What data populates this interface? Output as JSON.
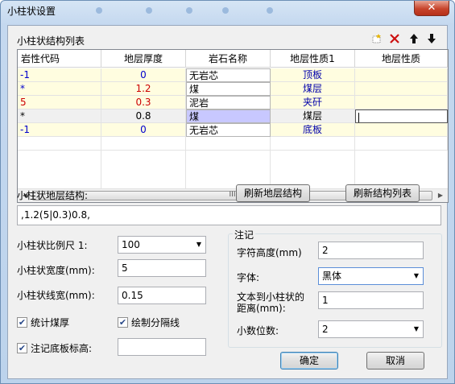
{
  "window": {
    "title": "小柱状设置",
    "close_glyph": "✕"
  },
  "grid": {
    "label": "小柱状结构列表",
    "columns": [
      "岩性代码",
      "地层厚度",
      "岩石名称",
      "地层性质1",
      "地层性质"
    ],
    "rows": [
      {
        "code": "-1",
        "thickness": "0",
        "rock": "无岩芯",
        "prop1": "顶板",
        "prop2": ""
      },
      {
        "code": "*",
        "thickness": "1.2",
        "rock": "煤",
        "prop1": "煤层",
        "prop2": ""
      },
      {
        "code": "5",
        "thickness": "0.3",
        "rock": "泥岩",
        "prop1": "夹矸",
        "prop2": ""
      },
      {
        "code": "*",
        "thickness": "0.8",
        "rock": "煤",
        "prop1": "煤层",
        "prop2": ""
      },
      {
        "code": "-1",
        "thickness": "0",
        "rock": "无岩芯",
        "prop1": "底板",
        "prop2": ""
      }
    ],
    "scroll_thumb_glyph": "III",
    "icons": {
      "new": "new-icon",
      "delete": "delete-icon",
      "up": "arrow-up-icon",
      "down": "arrow-down-icon"
    }
  },
  "structure": {
    "label": "小柱状地层结构:",
    "value": ",1.2(5|0.3)0.8,",
    "refresh_structure_button": "刷新地层结构",
    "refresh_list_button": "刷新结构列表"
  },
  "left_form": {
    "scale_label": "小柱状比例尺 1:",
    "scale_value": "100",
    "width_label": "小柱状宽度(mm):",
    "width_value": "5",
    "linewidth_label": "小柱状线宽(mm):",
    "linewidth_value": "0.15",
    "stat_coal_label": "统计煤厚",
    "stat_coal_checked": true,
    "draw_sep_label": "绘制分隔线",
    "draw_sep_checked": true,
    "bottom_elev_label": "注记底板标高:",
    "bottom_elev_checked": true,
    "bottom_elev_value": ""
  },
  "annotation": {
    "group_label": "注记",
    "char_height_label": "字符高度(mm)",
    "char_height_value": "2",
    "font_label": "字体:",
    "font_value": "黑体",
    "distance_label_1": "文本到小柱状的",
    "distance_label_2": "距离(mm):",
    "distance_value": "1",
    "decimals_label": "小数位数:",
    "decimals_value": "2"
  },
  "buttons": {
    "ok": "确定",
    "cancel": "取消"
  },
  "colors": {
    "row_yellow": "#fffde0",
    "row_selected": "#f0f0f0",
    "code_blue": "#0000cc",
    "code_red": "#cc0000",
    "prop_blue": "#0000aa",
    "accent": "#c7442b"
  }
}
